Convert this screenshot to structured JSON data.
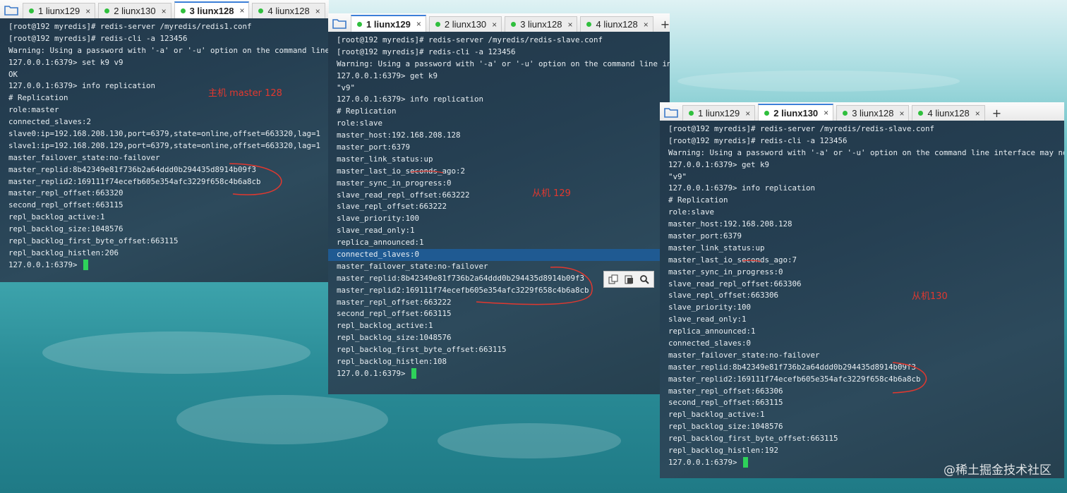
{
  "window1": {
    "tabs": [
      {
        "label": "1 liunx129",
        "active": false,
        "close": "×"
      },
      {
        "label": "2 liunx130",
        "active": false,
        "close": "×"
      },
      {
        "label": "3 liunx128",
        "active": true,
        "close": "×"
      },
      {
        "label": "4 liunx128",
        "active": false,
        "close": "×"
      }
    ],
    "lines": [
      "[root@192 myredis]# redis-server /myredis/redis1.conf",
      "[root@192 myredis]# redis-cli -a 123456",
      "Warning: Using a password with '-a' or '-u' option on the command line in",
      "127.0.0.1:6379> set k9 v9",
      "OK",
      "127.0.0.1:6379> info replication",
      "# Replication",
      "role:master",
      "connected_slaves:2",
      "slave0:ip=192.168.208.130,port=6379,state=online,offset=663320,lag=1",
      "slave1:ip=192.168.208.129,port=6379,state=online,offset=663320,lag=1",
      "master_failover_state:no-failover",
      "master_replid:8b42349e81f736b2a64ddd0b294435d8914b09f3",
      "master_replid2:169111f74ecefb605e354afc3229f658c4b6a8cb",
      "master_repl_offset:663320",
      "second_repl_offset:663115",
      "repl_backlog_active:1",
      "repl_backlog_size:1048576",
      "repl_backlog_first_byte_offset:663115",
      "repl_backlog_histlen:206"
    ],
    "prompt": "127.0.0.1:6379> ",
    "annotation": "主机 master 128"
  },
  "window2": {
    "tabs": [
      {
        "label": "1 liunx129",
        "active": true,
        "close": "×"
      },
      {
        "label": "2 liunx130",
        "active": false,
        "close": "×"
      },
      {
        "label": "3 liunx128",
        "active": false,
        "close": "×"
      },
      {
        "label": "4 liunx128",
        "active": false,
        "close": "×"
      }
    ],
    "plus": "+",
    "lines": [
      "[root@192 myredis]# redis-server /myredis/redis-slave.conf",
      "[root@192 myredis]# redis-cli -a 123456",
      "Warning: Using a password with '-a' or '-u' option on the command line interf",
      "127.0.0.1:6379> get k9",
      "\"v9\"",
      "127.0.0.1:6379> info replication",
      "# Replication",
      "role:slave",
      "master_host:192.168.208.128",
      "master_port:6379",
      "master_link_status:up",
      "master_last_io_seconds_ago:2",
      "master_sync_in_progress:0",
      "slave_read_repl_offset:663222",
      "slave_repl_offset:663222",
      "slave_priority:100",
      "slave_read_only:1",
      "replica_announced:1",
      "connected_slaves:0",
      "master_failover_state:no-failover",
      "master_replid:8b42349e81f736b2a64ddd0b294435d8914b09f3",
      "master_replid2:169111f74ecefb605e354afc3229f658c4b6a8cb",
      "master_repl_offset:663222",
      "second_repl_offset:663115",
      "repl_backlog_active:1",
      "repl_backlog_size:1048576",
      "repl_backlog_first_byte_offset:663115",
      "repl_backlog_histlen:108"
    ],
    "prompt": "127.0.0.1:6379> ",
    "annotation": "从机 129"
  },
  "window3": {
    "tabs": [
      {
        "label": "1 liunx129",
        "active": false,
        "close": "×"
      },
      {
        "label": "2 liunx130",
        "active": true,
        "close": "×"
      },
      {
        "label": "3 liunx128",
        "active": false,
        "close": "×"
      },
      {
        "label": "4 liunx128",
        "active": false,
        "close": "×"
      }
    ],
    "plus": "+",
    "lines": [
      "[root@192 myredis]# redis-server /myredis/redis-slave.conf",
      "[root@192 myredis]# redis-cli -a 123456",
      "Warning: Using a password with '-a' or '-u' option on the command line interface may not b",
      "127.0.0.1:6379> get k9",
      "\"v9\"",
      "127.0.0.1:6379> info replication",
      "# Replication",
      "role:slave",
      "master_host:192.168.208.128",
      "master_port:6379",
      "master_link_status:up",
      "master_last_io_seconds_ago:7",
      "master_sync_in_progress:0",
      "slave_read_repl_offset:663306",
      "slave_repl_offset:663306",
      "slave_priority:100",
      "slave_read_only:1",
      "replica_announced:1",
      "connected_slaves:0",
      "master_failover_state:no-failover",
      "master_replid:8b42349e81f736b2a64ddd0b294435d8914b09f3",
      "master_replid2:169111f74ecefb605e354afc3229f658c4b6a8cb",
      "master_repl_offset:663306",
      "second_repl_offset:663115",
      "repl_backlog_active:1",
      "repl_backlog_size:1048576",
      "repl_backlog_first_byte_offset:663115",
      "repl_backlog_histlen:192"
    ],
    "prompt": "127.0.0.1:6379> ",
    "annotation": "从机130"
  },
  "watermark": "@稀土掘金技术社区",
  "colors": {
    "annotation": "#e2382f",
    "cursor": "#2ed25a",
    "active_tab_accent": "#3c7fd8",
    "selection": "#1f5a92"
  },
  "icons": {
    "folder": "folder-icon",
    "copy": "copy-icon",
    "paste": "paste-icon",
    "search": "search-icon"
  }
}
